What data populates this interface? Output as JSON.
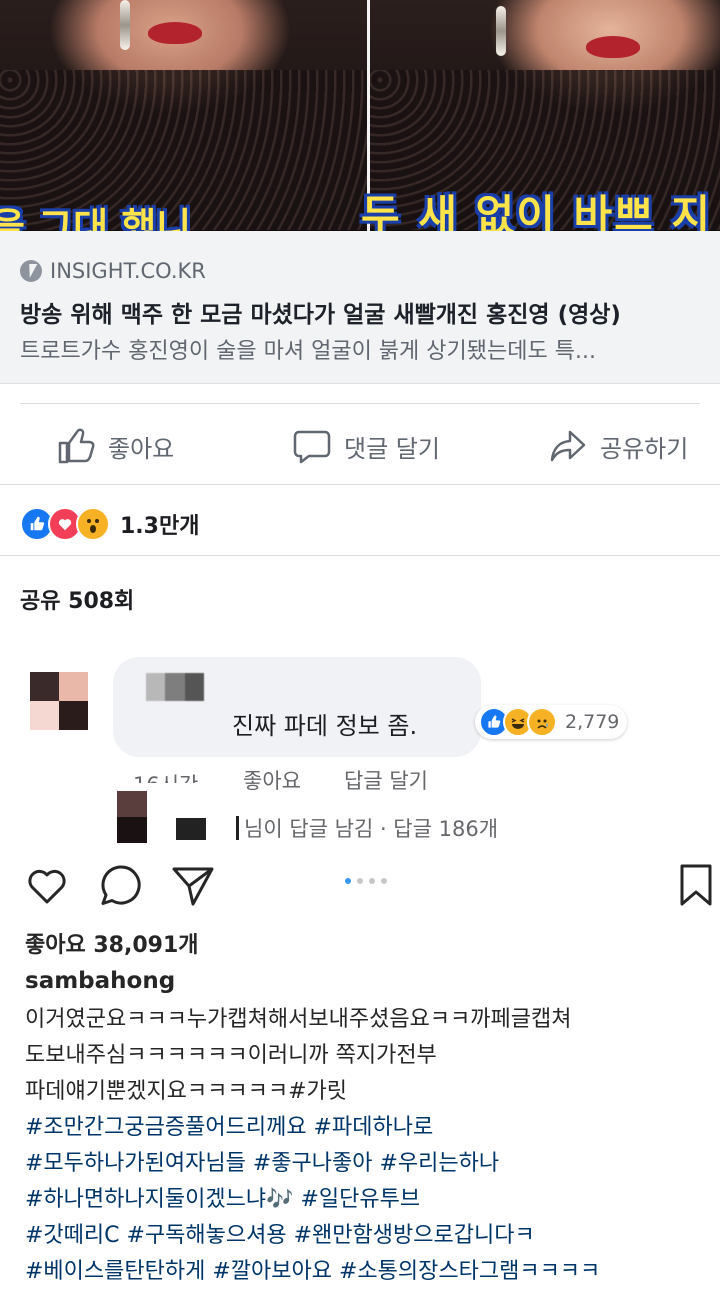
{
  "video": {
    "subtitle_right": "두 새 없이 바쁘 지",
    "subtitle_left": "을 그대 했니"
  },
  "link_preview": {
    "domain": "INSIGHT.CO.KR",
    "title": "방송 위해 맥주 한 모금 마셨다가 얼굴 새빨개진 홍진영 (영상)",
    "description": "트로트가수 홍진영이 술을 마셔 얼굴이 붉게 상기됐는데도 특..."
  },
  "actions": {
    "like": "좋아요",
    "comment": "댓글 달기",
    "share": "공유하기"
  },
  "reactions": {
    "count": "1.3만개",
    "types": [
      "like",
      "love",
      "wow"
    ]
  },
  "share_count": "공유 508회",
  "comment": {
    "text": "진짜 파데 정보 좀.",
    "reaction_count": "2,779",
    "time": "16시간",
    "like_label": "좋아요",
    "reply_label": "답글 달기",
    "reply_summary": "님이 답글 남김 · 답글 186개"
  },
  "instagram": {
    "likes": "좋아요 38,091개",
    "username": "sambahong",
    "carousel": {
      "count": 4,
      "active": 0
    },
    "caption_lines": [
      "이거였군요ㅋㅋㅋ누가캡쳐해서보내주셨음요ㅋㅋ까페글캡쳐",
      "도보내주심ㅋㅋㅋㅋㅋㅋ이러니까 쪽지가전부",
      "파데얘기뿐겠지요ㅋㅋㅋㅋㅋ#가릿"
    ],
    "hashtag_lines": [
      "#조만간그궁금증풀어드리께요 #파데하나로",
      "#모두하나가된여자님들 #좋구나좋아 #우리는하나",
      "#하나면하나지둘이겠느냐🎶 #일단유투브",
      "#갓떼리C #구독해놓으셔용 #왠만함생방으로갑니다ㅋ",
      "#베이스를탄탄하게 #깔아보아요 #소통의장스타그램ㅋㅋㅋㅋ"
    ]
  }
}
